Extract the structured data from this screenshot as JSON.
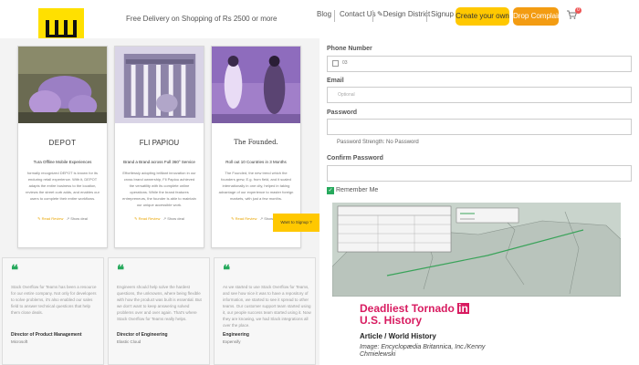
{
  "header": {
    "tagline": "Free Delivery on Shopping of Rs 2500 or more",
    "nav": [
      "Blog",
      "Contact Us",
      "Design District",
      "Signup"
    ],
    "create_own": "Create your own",
    "drop_complaint": "Drop Complaint",
    "cart_count": "0",
    "colors": {
      "accent_yellow": "#ffc800",
      "accent_orange": "#f39c12"
    }
  },
  "cards": [
    {
      "title": "DEPOT",
      "subtitle": "Tura Offline Mobile Experiences",
      "body": "formally recognized DEPOT is known for its enduring retail experience. With it, DEPOT adapts the entire business to the location, reviews the street curb adds, and enables our users to complete their entire workflows.",
      "read_more": "Read Review",
      "show_deal": "Show deal"
    },
    {
      "title": "FLI PAPIOU",
      "subtitle": "Brand a Brand across Full 360° Service",
      "body": "Effortlessly adopting brilliant innovation in our cross brand ownership, Fli Papiou achieved the versatility with its complete online operations. While the brand features entrepreneurs, the founder is able to maintain our unique accessible work.",
      "read_more": "Read Review",
      "show_deal": "Show deal"
    },
    {
      "title": "The Founded.",
      "subtitle": "Roll out 10 Countries in 3 Months",
      "body": "The Founded, the new trend which the founders grew, E.g. from field, and it scaled internationally in one city, helped in taking advantage of our experience to master foreign markets, with just a few months.",
      "read_more": "Read Review",
      "show_deal": "Show deal"
    }
  ],
  "signup_tab": "Want to Signup ?",
  "testimonials": [
    {
      "text": "Stack Overflow for Teams has been a resource for our entire company. Not only for developers to solve problems, it's also enabled our sales field to answer technical questions that help them close deals.",
      "role": "Director of Product Management",
      "company": "Microsoft"
    },
    {
      "text": "Engineers should help solve the hardest questions, the unknowns, where being flexible with how the product was built is essential. But we don't want to keep answering solved problems over and over again. That's where Stack Overflow for Teams really helps.",
      "role": "Director of Engineering",
      "company": "Elastic Cloud"
    },
    {
      "text": "As we started to use Stack Overflow for Teams, and see how nice it was to have a repository of information, we started to see it spread to other teams. Our customer support team started using it, our people success team started using it. Now they are knowing, we had Slack integrations all over the place.",
      "role": "Engineering",
      "company": "Expensify"
    }
  ],
  "form": {
    "phone_label": "Phone Number",
    "phone_value": "03",
    "email_label": "Email",
    "email_placeholder": "Optional",
    "password_label": "Password",
    "strength": "Password Strength: No Password",
    "confirm_label": "Confirm Password",
    "remember": "Remember Me"
  },
  "tornado_card": {
    "title_line1_pre": "Deadliest Tornado",
    "title_line1_box": "in",
    "title_line2": "U.S. History",
    "category": "Article / World History",
    "credit": "Image: Encyclopædia Britannica, Inc./Kenny Chmielewski"
  }
}
